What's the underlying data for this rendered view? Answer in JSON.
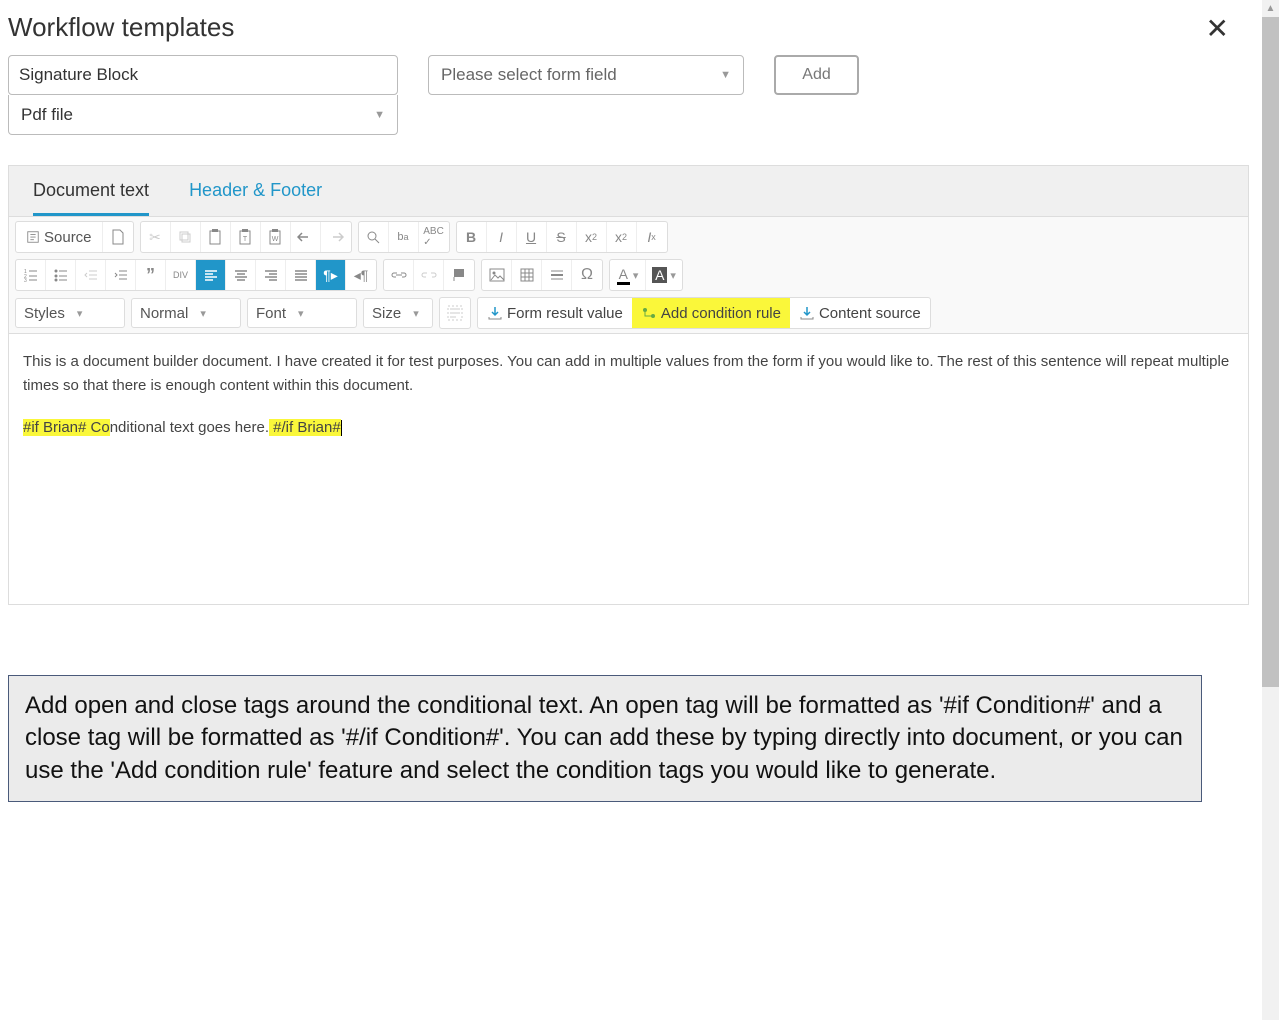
{
  "header": {
    "title": "Workflow templates"
  },
  "inputs": {
    "template_name": "Signature Block",
    "form_field_placeholder": "Please select form field",
    "file_type": "Pdf file",
    "add_button": "Add"
  },
  "tabs": {
    "document_text": "Document text",
    "header_footer": "Header & Footer"
  },
  "toolbar": {
    "source": "Source",
    "styles": "Styles",
    "format": "Normal",
    "font": "Font",
    "size": "Size",
    "form_result": "Form result value",
    "add_condition": "Add condition rule",
    "content_source": "Content source"
  },
  "content": {
    "paragraph": "This is a document builder document. I have created it for test purposes. You can add in multiple values from the form if you would like to. The rest of this sentence will repeat multiple times so that there is enough content within this document.",
    "cond_open": "#if Brian# Co",
    "cond_mid": "nditional text goes here.",
    "cond_close": " #/if Brian#"
  },
  "info": {
    "text": "Add open and close tags around the conditional text. An open tag will be formatted as '#if Condition#' and a close tag will be formatted as '#/if Condition#'. You can add these by typing directly into document, or you can use the 'Add condition rule' feature and select the condition tags you would like to generate."
  }
}
